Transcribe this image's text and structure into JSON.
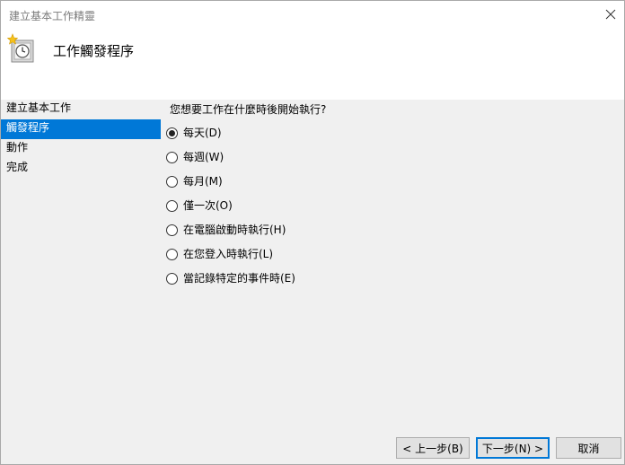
{
  "window": {
    "title": "建立基本工作精靈"
  },
  "header": {
    "title": "工作觸發程序",
    "icon": "scheduled-task-clock-icon"
  },
  "sidebar": {
    "items": [
      {
        "label": "建立基本工作",
        "active": false
      },
      {
        "label": "觸發程序",
        "active": true
      },
      {
        "label": "動作",
        "active": false
      },
      {
        "label": "完成",
        "active": false
      }
    ]
  },
  "content": {
    "question": "您想要工作在什麼時後開始執行?",
    "options": [
      {
        "label": "每天(D)",
        "checked": true
      },
      {
        "label": "每週(W)",
        "checked": false
      },
      {
        "label": "每月(M)",
        "checked": false
      },
      {
        "label": "僅一次(O)",
        "checked": false
      },
      {
        "label": "在電腦啟動時執行(H)",
        "checked": false
      },
      {
        "label": "在您登入時執行(L)",
        "checked": false
      },
      {
        "label": "當記錄特定的事件時(E)",
        "checked": false
      }
    ]
  },
  "footer": {
    "back_label": "< 上一步(B)",
    "next_label": "下一步(N) >",
    "cancel_label": "取消"
  },
  "colors": {
    "accent": "#0078d7",
    "background": "#f0f0f0"
  }
}
